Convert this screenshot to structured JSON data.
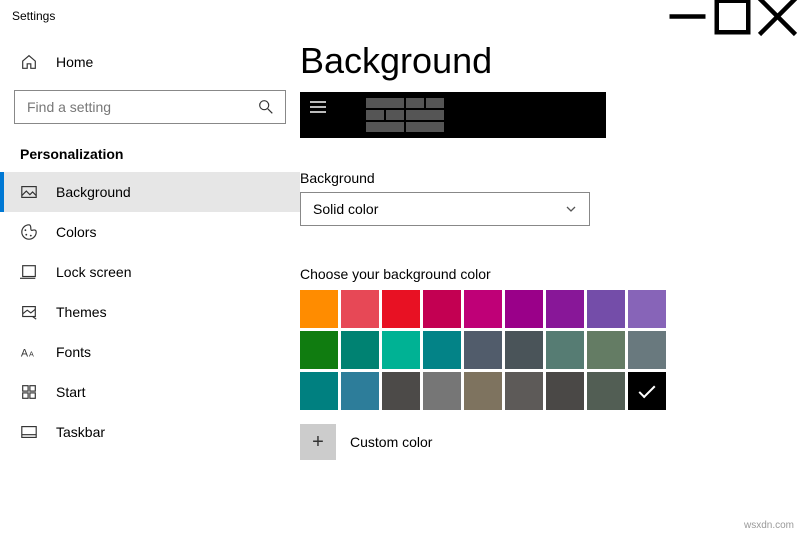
{
  "window": {
    "title": "Settings"
  },
  "sidebar": {
    "home": "Home",
    "search_placeholder": "Find a setting",
    "section": "Personalization",
    "items": [
      {
        "label": "Background"
      },
      {
        "label": "Colors"
      },
      {
        "label": "Lock screen"
      },
      {
        "label": "Themes"
      },
      {
        "label": "Fonts"
      },
      {
        "label": "Start"
      },
      {
        "label": "Taskbar"
      }
    ]
  },
  "main": {
    "heading": "Background",
    "bg_label": "Background",
    "bg_value": "Solid color",
    "choose_label": "Choose your background color",
    "custom_label": "Custom color",
    "colors_row1": [
      "#ff8c00",
      "#e74856",
      "#e81123",
      "#c30052",
      "#bf0077",
      "#9a0089",
      "#881798",
      "#744da9",
      "#8764b8"
    ],
    "colors_row2": [
      "#107c10",
      "#008272",
      "#00b294",
      "#038387",
      "#515c6b",
      "#4a5459",
      "#567c73",
      "#647c64",
      "#69797e"
    ],
    "colors_row3": [
      "#008080",
      "#2d7d9a",
      "#4c4a48",
      "#767676",
      "#7e735f",
      "#5d5a58",
      "#4a4846",
      "#525e54",
      "#000000"
    ],
    "selected": "#000000"
  },
  "watermark": "wsxdn.com"
}
